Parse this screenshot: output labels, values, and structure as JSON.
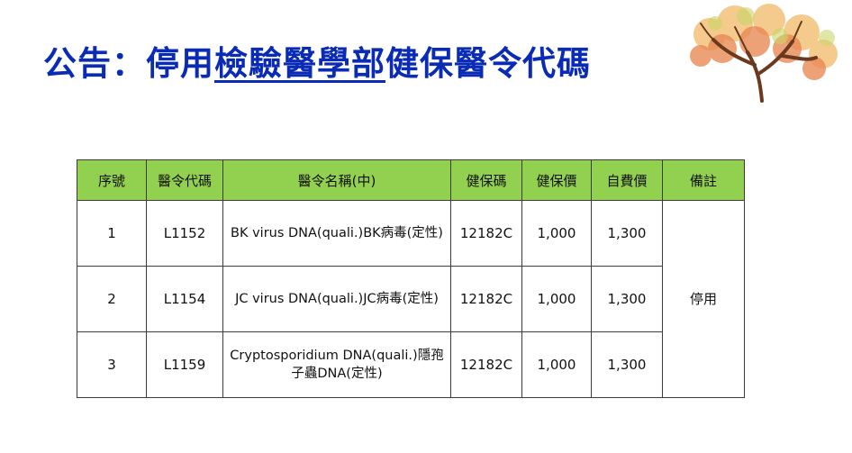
{
  "title": {
    "prefix": "公告：停用",
    "underlined": "檢驗醫學部",
    "suffix": "健保醫令代碼"
  },
  "table": {
    "headers": [
      "序號",
      "醫令代碼",
      "醫令名稱(中)",
      "健保碼",
      "健保價",
      "自費價",
      "備註"
    ],
    "rows": [
      {
        "no": "1",
        "code": "L1152",
        "name": "BK virus DNA(quali.)BK病毒(定性)",
        "nhi_code": "12182C",
        "nhi_price": "1,000",
        "self_price": "1,300"
      },
      {
        "no": "2",
        "code": "L1154",
        "name": "JC virus DNA(quali.)JC病毒(定性)",
        "nhi_code": "12182C",
        "nhi_price": "1,000",
        "self_price": "1,300"
      },
      {
        "no": "3",
        "code": "L1159",
        "name": "Cryptosporidium DNA(quali.)隱孢子蟲DNA(定性)",
        "nhi_code": "12182C",
        "nhi_price": "1,000",
        "self_price": "1,300"
      }
    ],
    "remark": "停用"
  },
  "colors": {
    "title": "#0a2bb5",
    "header_bg": "#92d050",
    "border": "#3c3c3c"
  },
  "decoration": "autumn-tree-illustration"
}
